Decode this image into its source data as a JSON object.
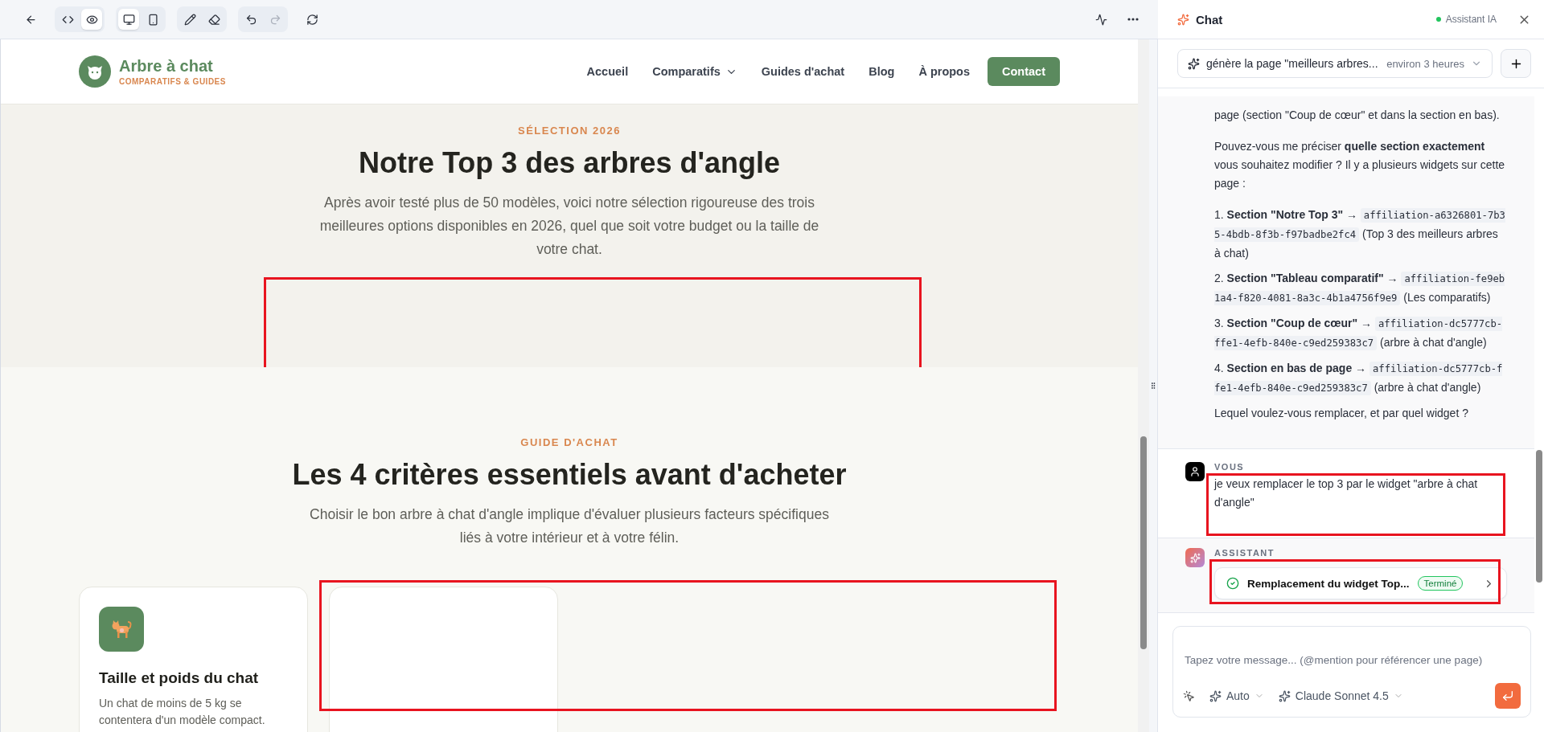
{
  "toolbar": {
    "left_groups": [
      [
        {
          "kind": "back",
          "selected": false,
          "disabled": false
        }
      ],
      [
        {
          "kind": "code",
          "selected": false,
          "disabled": false
        },
        {
          "kind": "preview",
          "selected": true,
          "disabled": false
        }
      ],
      [
        {
          "kind": "desktop",
          "selected": true,
          "disabled": false
        },
        {
          "kind": "mobile",
          "selected": false,
          "disabled": false
        }
      ],
      [
        {
          "kind": "pencil",
          "selected": false,
          "disabled": false
        },
        {
          "kind": "eraser",
          "selected": false,
          "disabled": false
        }
      ],
      [
        {
          "kind": "undo",
          "selected": false,
          "disabled": false
        },
        {
          "kind": "redo",
          "selected": false,
          "disabled": true
        }
      ],
      [
        {
          "kind": "refresh",
          "selected": false,
          "disabled": false
        }
      ]
    ],
    "right": [
      {
        "kind": "activity",
        "selected": false,
        "disabled": false
      },
      {
        "kind": "more",
        "selected": false,
        "disabled": false
      }
    ]
  },
  "site": {
    "logo": {
      "name": "Arbre à chat",
      "tagline": "COMPARATIFS & GUIDES"
    },
    "nav": [
      {
        "label": "Accueil",
        "dropdown": false
      },
      {
        "label": "Comparatifs",
        "dropdown": true
      },
      {
        "label": "Guides d'achat",
        "dropdown": false
      },
      {
        "label": "Blog",
        "dropdown": false
      },
      {
        "label": "À propos",
        "dropdown": false
      }
    ],
    "cta": "Contact",
    "top_section": {
      "eyebrow": "SÉLECTION 2026",
      "title": "Notre Top 3 des arbres d'angle",
      "intro": "Après avoir testé plus de 50 modèles, voici notre sélection rigoureuse des trois meilleures options disponibles en 2026, quel que soit votre budget ou la taille de votre chat.",
      "widget_highlighted": true
    },
    "guide_section": {
      "eyebrow": "GUIDE D'ACHAT",
      "title": "Les 4 critères essentiels avant d'acheter",
      "intro": "Choisir le bon arbre à chat d'angle implique d'évaluer plusieurs facteurs spécifiques liés à votre intérieur et à votre félin.",
      "cards_highlighted": true,
      "cards": [
        {
          "kind": "criterion",
          "title": "Taille et poids du chat",
          "text": "Un chat de moins de 5 kg se contentera d'un modèle compact."
        },
        {
          "kind": "empty"
        }
      ]
    }
  },
  "chat": {
    "title": "Chat",
    "status": "Assistant IA",
    "session": {
      "title": "génère la page \"meilleurs arbres...",
      "time": "environ 3 heures"
    },
    "messages": [
      {
        "kind": "reply",
        "highlighted": false,
        "blocks": [
          {
            "kind": "paragraph",
            "text": "page (section \"Coup de cœur\" et dans la section en bas)."
          },
          {
            "kind": "paragraph",
            "text": "Pouvez-vous me préciser **quelle section exactement** vous souhaitez modifier ? Il y a plusieurs widgets sur cette page :"
          },
          {
            "kind": "item",
            "number": "1.",
            "section": "Section \"Notre Top 3\"",
            "arrow": "→",
            "code": "affiliation-a6326801-7b35-4bdb-8f3b-f97badbe2fc4",
            "note": "(Top 3 des meilleurs arbres à chat)"
          },
          {
            "kind": "item",
            "number": "2.",
            "section": "Section \"Tableau comparatif\"",
            "arrow": "→",
            "code": "affiliation-fe9eb1a4-f820-4081-8a3c-4b1a4756f9e9",
            "note": "(Les comparatifs)"
          },
          {
            "kind": "item",
            "number": "3.",
            "section": "Section \"Coup de cœur\"",
            "arrow": "→",
            "code": "affiliation-dc5777cb-ffe1-4efb-840e-c9ed259383c7",
            "note": "(arbre à chat d'angle)"
          },
          {
            "kind": "item",
            "number": "4.",
            "section": "Section en bas de page",
            "arrow": "→",
            "code": "affiliation-dc5777cb-ffe1-4efb-840e-c9ed259383c7",
            "note": "(arbre à chat d'angle)"
          },
          {
            "kind": "paragraph",
            "text": "Lequel voulez-vous remplacer, et par quel widget ?"
          }
        ]
      },
      {
        "kind": "prompt",
        "author": "VOUS",
        "highlighted": true,
        "blocks": [
          {
            "kind": "paragraph",
            "text": "je veux remplacer le top 3 par le widget \"arbre à chat d'angle\""
          }
        ]
      },
      {
        "kind": "task",
        "author": "ASSISTANT",
        "highlighted": true,
        "task": {
          "title": "Remplacement du widget Top...",
          "status": "Terminé",
          "done": true
        }
      }
    ],
    "input": {
      "placeholder": "Tapez votre message... (@mention pour référencer une page)",
      "mode": "Auto",
      "model": "Claude Sonnet 4.5"
    }
  }
}
